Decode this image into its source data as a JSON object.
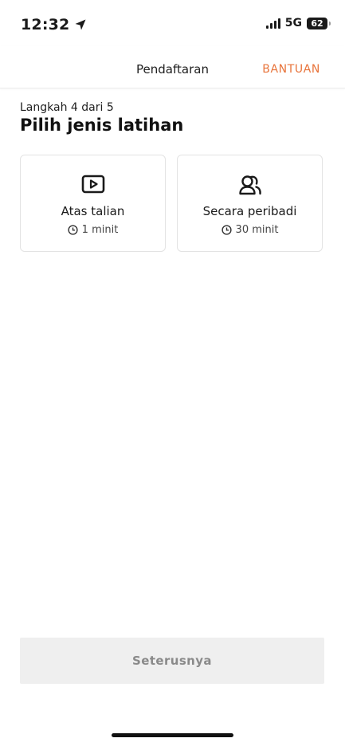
{
  "status_bar": {
    "time": "12:32",
    "network": "5G",
    "battery": "62"
  },
  "header": {
    "title": "Pendaftaran",
    "help_label": "BANTUAN",
    "accent_color": "#e8743b"
  },
  "step": {
    "label": "Langkah 4 dari 5",
    "title": "Pilih jenis latihan"
  },
  "options": [
    {
      "title": "Atas talian",
      "duration": "1 minit",
      "icon": "play-screen-icon"
    },
    {
      "title": "Secara peribadi",
      "duration": "30 minit",
      "icon": "people-icon"
    }
  ],
  "footer": {
    "next_label": "Seterusnya",
    "next_disabled": true
  }
}
